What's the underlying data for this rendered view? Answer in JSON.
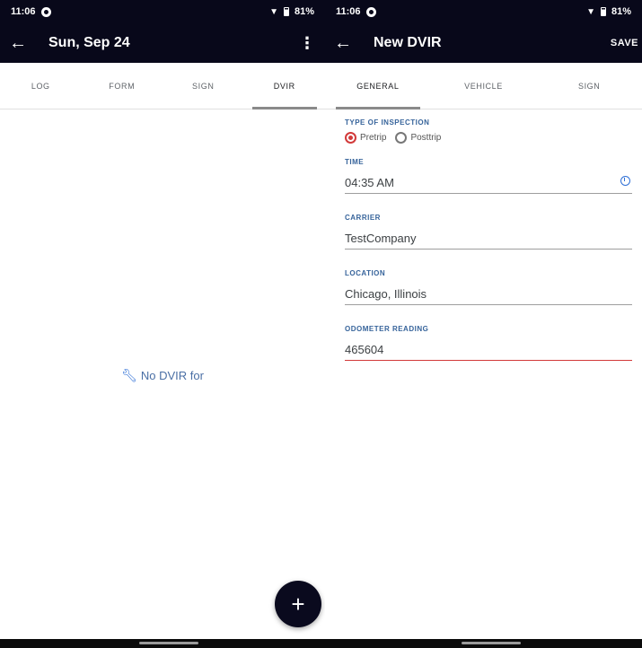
{
  "left": {
    "status": {
      "time": "11:06",
      "battery": "81%"
    },
    "appbar": {
      "title": "Sun, Sep 24"
    },
    "tabs": [
      {
        "label": "LOG"
      },
      {
        "label": "FORM"
      },
      {
        "label": "SIGN"
      },
      {
        "label": "DVIR"
      }
    ],
    "active_tab": "DVIR",
    "empty_message": "No DVIR for",
    "fab": {
      "symbol": "+"
    }
  },
  "right": {
    "status": {
      "time": "11:06",
      "battery": "81%"
    },
    "appbar": {
      "title": "New DVIR",
      "save_label": "SAVE"
    },
    "tabs": [
      {
        "label": "GENERAL"
      },
      {
        "label": "VEHICLE"
      },
      {
        "label": "SIGN"
      }
    ],
    "active_tab": "GENERAL",
    "form": {
      "inspection_type": {
        "label": "TYPE OF INSPECTION",
        "options": [
          {
            "label": "Pretrip",
            "checked": true
          },
          {
            "label": "Posttrip",
            "checked": false
          }
        ]
      },
      "time": {
        "label": "TIME",
        "value": "04:35 AM"
      },
      "carrier": {
        "label": "CARRIER",
        "value": "TestCompany"
      },
      "location": {
        "label": "LOCATION",
        "value": "Chicago, Illinois"
      },
      "odometer": {
        "label": "ODOMETER READING",
        "value": "465604"
      }
    }
  },
  "colors": {
    "appbar_bg": "#08081a",
    "accent_red": "#d23a3a",
    "label_blue": "#37649b",
    "icon_blue": "#2e6fd6"
  },
  "icons": [
    "back-arrow-icon",
    "more-vert-icon",
    "wrench-icon",
    "add-icon",
    "clock-icon",
    "wifi-icon",
    "battery-icon"
  ]
}
